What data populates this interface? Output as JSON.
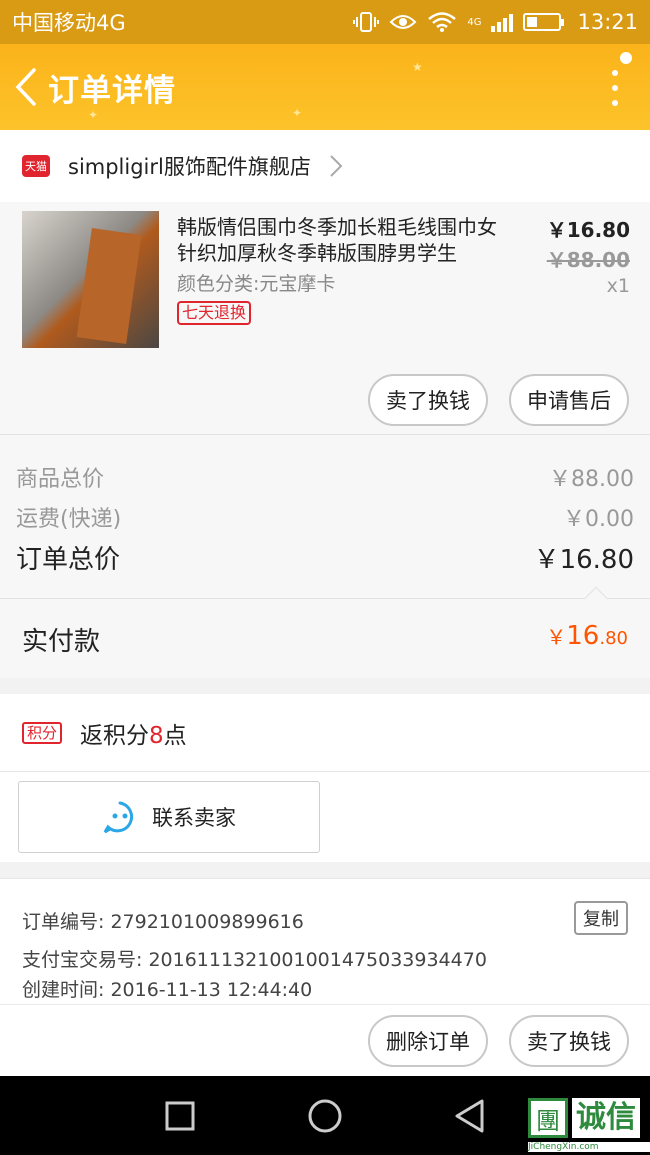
{
  "status_bar": {
    "carrier": "中国移动4G",
    "network": "4G",
    "time": "13:21"
  },
  "header": {
    "title": "订单详情"
  },
  "shop": {
    "platform_badge": "天猫",
    "name": "simpligirl服饰配件旗舰店"
  },
  "item": {
    "title": "韩版情侣围巾冬季加长粗毛线围巾女针织加厚秋冬季韩版围脖男学生",
    "attribute": "颜色分类:元宝摩卡",
    "return_tag": "七天退换",
    "price": "￥16.80",
    "original_price": "￥88.00",
    "quantity": "x1",
    "actions": [
      "卖了换钱",
      "申请售后"
    ]
  },
  "summary": {
    "goods_total_label": "商品总价",
    "goods_total": "￥88.00",
    "shipping_label": "运费(快递)",
    "shipping": "￥0.00",
    "order_total_label": "订单总价",
    "order_total": "￥16.80"
  },
  "payment": {
    "label": "实付款",
    "currency": "￥",
    "int": "16",
    "dec": ".80"
  },
  "points": {
    "badge": "积分",
    "prefix": "返积分",
    "value": "8",
    "suffix": "点"
  },
  "contact": {
    "label": "联系卖家"
  },
  "order_info": {
    "order_no": "订单编号: 2792101009899616",
    "alipay_no": "支付宝交易号: 2016111321001001475033934470",
    "created": "创建时间: 2016-11-13 12:44:40",
    "copy_label": "复制"
  },
  "bottom_actions": {
    "delete": "删除订单",
    "sell": "卖了换钱"
  },
  "watermark": {
    "main": "诚信",
    "sub": "JiChengXin.com"
  },
  "colors": {
    "accent": "#fbb31a",
    "price_red": "#ff5500",
    "tmall_red": "#e1252f"
  }
}
